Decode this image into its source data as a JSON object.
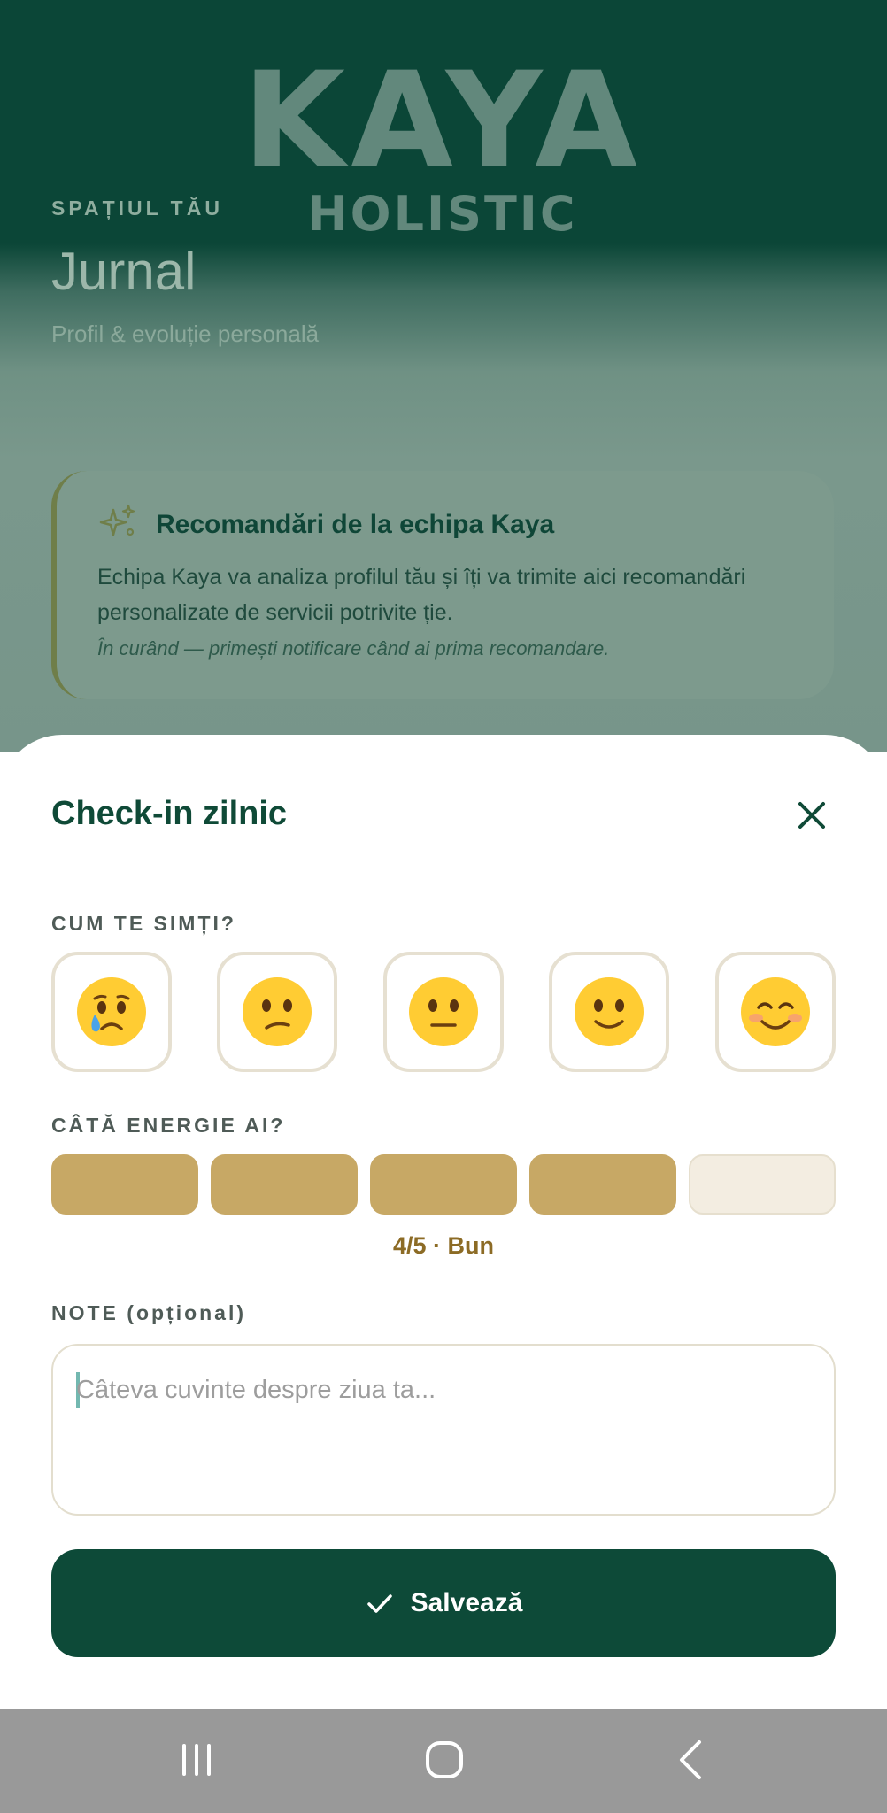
{
  "background": {
    "logo": {
      "word": "KAYA",
      "sub": "HOLISTIC"
    },
    "eyebrow": "SPAȚIUL TĂU",
    "title": "Jurnal",
    "subtitle": "Profil & evoluție personală",
    "recommendation": {
      "icon": "sparkles-icon",
      "title": "Recomandări de la echipa Kaya",
      "body": "Echipa Kaya va analiza profilul tău și îți va trimite aici recomandări personalizate de servicii potrivite ție.",
      "note": "În curând — primești notificare când ai prima recomandare."
    }
  },
  "sheet": {
    "title": "Check-in zilnic",
    "close_icon": "close-icon",
    "mood": {
      "label": "CUM TE SIMȚI?",
      "options": [
        "crying-face",
        "confused-face",
        "neutral-face",
        "slightly-smiling-face",
        "smiling-blushing-face"
      ]
    },
    "energy": {
      "label": "CÂTĂ ENERGIE AI?",
      "level": 4,
      "max": 5,
      "readout": "4/5 · Bun"
    },
    "notes": {
      "label": "NOTE (opțional)",
      "value": "",
      "placeholder": "Câteva cuvinte despre ziua ta..."
    },
    "save": {
      "label": "Salvează",
      "icon": "check-icon"
    }
  },
  "colors": {
    "brand_dark": "#0d4a38",
    "gold": "#c7a865",
    "gold_text": "#8c6b25",
    "bar_empty": "#f3ede1"
  },
  "navbar": {
    "icons": [
      "recent-apps-icon",
      "home-icon",
      "back-icon"
    ]
  }
}
